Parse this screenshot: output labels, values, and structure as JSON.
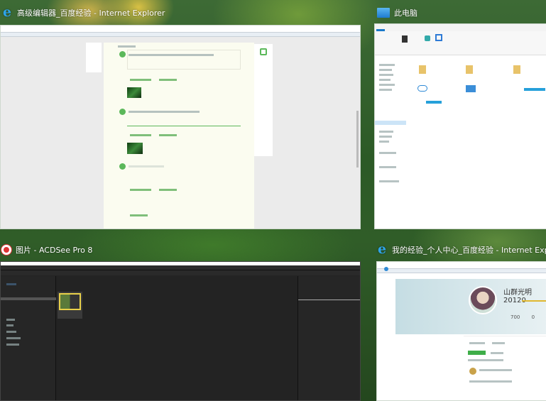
{
  "windows": [
    {
      "title": "高级编辑器_百度经验 - Internet Explorer",
      "icon": "ie-icon"
    },
    {
      "title": "此电脑",
      "icon": "computer-icon"
    },
    {
      "title": "图片 - ACDSee Pro 8",
      "icon": "acdsee-icon"
    },
    {
      "title": "我的经验_个人中心_百度经验 - Internet Explorer",
      "icon": "ie-icon"
    }
  ],
  "profile": {
    "username": "山群光明20120",
    "stat1": "700",
    "stat2": "0"
  },
  "colors": {
    "baidu_green": "#5bb85a",
    "acdsee_bg": "#222222",
    "ie_blue": "#2ea3e8"
  }
}
